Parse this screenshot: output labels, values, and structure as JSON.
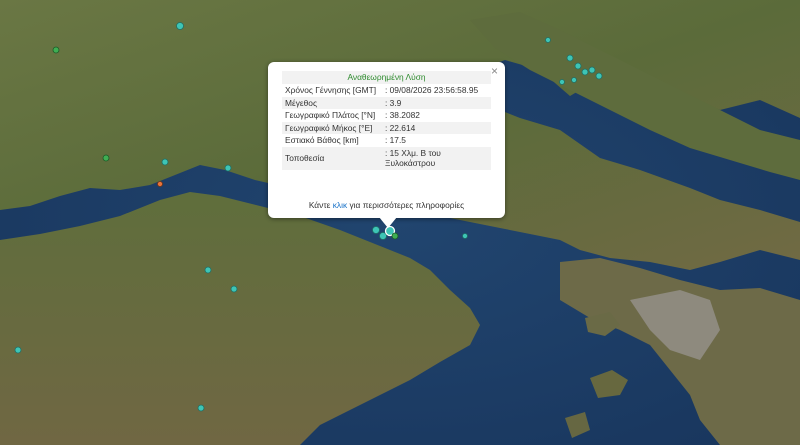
{
  "popup": {
    "title": "Αναθεωρημένη Λύση",
    "rows": [
      {
        "label": "Χρόνος Γέννησης [GMT]",
        "value": ": 09/08/2026 23:56:58.95"
      },
      {
        "label": "Μέγεθος",
        "value": ": 3.9"
      },
      {
        "label": "Γεωγραφικό Πλάτος [°N]",
        "value": ": 38.2082"
      },
      {
        "label": "Γεωγραφικό Μήκος [°E]",
        "value": ": 22.614"
      },
      {
        "label": "Εστιακό Βάθος [km]",
        "value": ": 17.5"
      },
      {
        "label": "Τοποθεσία",
        "value": ": 15 Χλμ. Β του Ξυλοκάστρου"
      }
    ],
    "footer_before": "Κάντε ",
    "footer_link": "κλικ",
    "footer_after": " για περισσότερες πληροφορίες",
    "close": "×"
  },
  "map_colors": {
    "sea": "#1d3d66",
    "land": "#5d6b3c",
    "marker": "#3ec5b6",
    "marker_green": "#3fae53",
    "marker_orange": "#e7743b"
  }
}
